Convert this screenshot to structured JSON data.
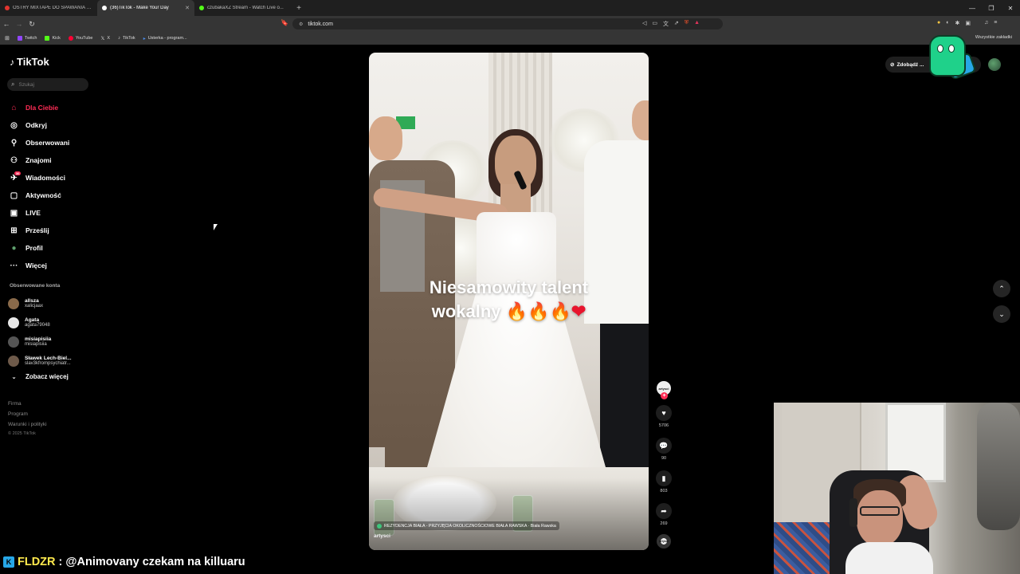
{
  "browser": {
    "tabs": [
      {
        "label": "OSTRY MIXTAPE DO SPAWANIA POC...",
        "fav_color": "#e2352f"
      },
      {
        "label": "(36)TikTok - Make Your Day",
        "fav_color": "#ffffff"
      },
      {
        "label": "czubakaXZ Stream - Watch Live o...",
        "fav_color": "#53fc18"
      }
    ],
    "active_tab": 1,
    "url": "tiktok.com",
    "bookmarks": [
      {
        "label": "Twitch",
        "color": "#9146ff"
      },
      {
        "label": "Kick",
        "color": "#53fc18"
      },
      {
        "label": "YouTube",
        "color": "#ff0033"
      },
      {
        "label": "X",
        "color": "#ffffff"
      },
      {
        "label": "TikTok",
        "color": "#ffffff"
      },
      {
        "label": "Usterka - program...",
        "color": "#4a8ef0"
      }
    ],
    "bookmarks_right": "Wszystkie zakładki"
  },
  "tiktok": {
    "logo": "TikTok",
    "search_placeholder": "Szukaj",
    "menu": [
      {
        "label": "Dla Ciebie",
        "icon": "home-icon",
        "active": true
      },
      {
        "label": "Odkryj",
        "icon": "compass-icon"
      },
      {
        "label": "Obserwowani",
        "icon": "user-follow-icon"
      },
      {
        "label": "Znajomi",
        "icon": "friends-icon"
      },
      {
        "label": "Wiadomości",
        "icon": "messages-icon",
        "badge": "36"
      },
      {
        "label": "Aktywność",
        "icon": "activity-icon"
      },
      {
        "label": "LIVE",
        "icon": "live-icon"
      },
      {
        "label": "Prześlij",
        "icon": "upload-icon"
      },
      {
        "label": "Profil",
        "icon": "profile-icon"
      },
      {
        "label": "Więcej",
        "icon": "more-icon"
      }
    ],
    "followed_title": "Obserwowane konta",
    "followed": [
      {
        "name": "allsza",
        "user": "xalicjaax",
        "color": "#8a6a4a"
      },
      {
        "name": "Agata",
        "user": "agata79048",
        "color": "#e8e8e8"
      },
      {
        "name": "misiapisiia",
        "user": "misiapisiia",
        "color": "#555555"
      },
      {
        "name": "Sławek Lech-Biel...",
        "user": "slav3kfrompsychiatr...",
        "color": "#6e5a4a"
      }
    ],
    "see_more": "Zobacz więcej",
    "footer": [
      "Firma",
      "Program",
      "Warunki i polityki"
    ],
    "copyright": "© 2025 TikTok",
    "get_app": "Zdobądź ...",
    "video": {
      "caption_line1": "Niesamowity talent",
      "caption_line2": "wokalny",
      "caption_emoji": "🔥🔥🔥",
      "caption_heart": "❤",
      "place": "REZYDENCJA BIAŁA - PRZYJĘCIA OKOLICZNOŚCIOWE BIAŁA RAWSKA · Biała Rawska",
      "author": "artysci"
    },
    "actions": {
      "creator_label": "artysci",
      "likes": "5706",
      "comments": "90",
      "saves": "803",
      "shares": "269",
      "music_label": "artysci"
    }
  },
  "chat": {
    "user": "FLDZR",
    "message": ": @Animovany czekam na killuaru"
  }
}
